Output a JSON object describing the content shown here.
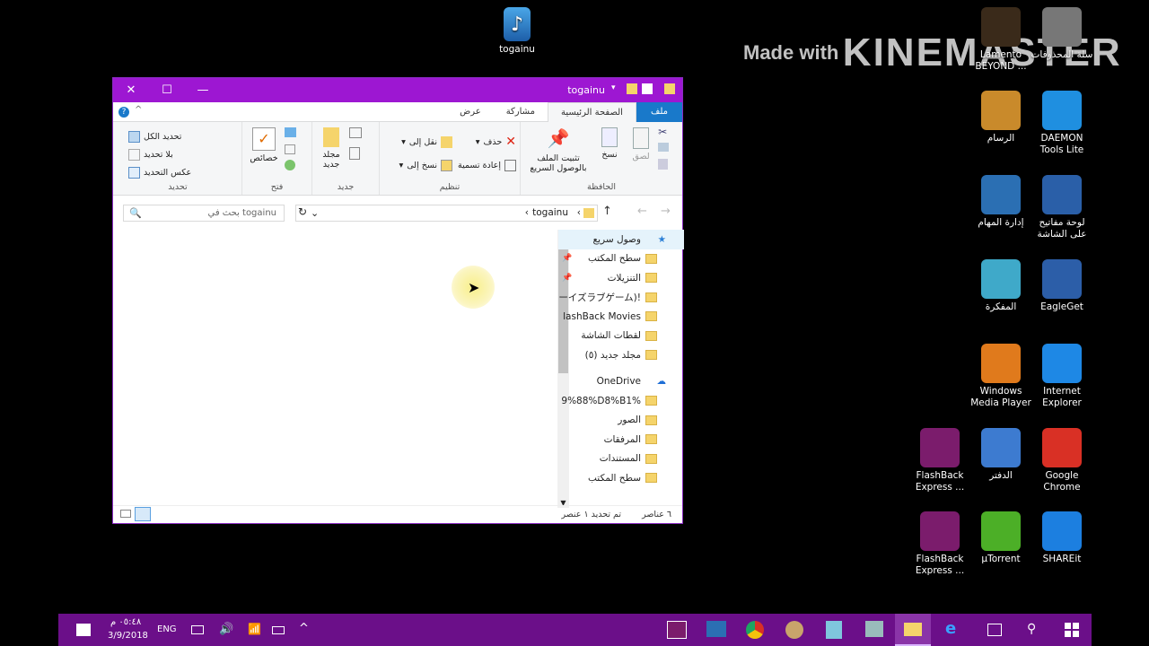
{
  "watermark": {
    "prefix": "Made with",
    "brand": "KINEMASTER"
  },
  "desktop": {
    "top_icon": {
      "label": "togainu"
    },
    "icons": [
      {
        "label": "Lamento BEYOND ...",
        "name": "lamento-icon",
        "color": "#3a2a1a"
      },
      {
        "label": "سلة المحذوفات",
        "name": "recycle-bin-icon",
        "color": "#777777"
      },
      {
        "label": "الرسام",
        "name": "paint-icon",
        "color": "#c98a2b"
      },
      {
        "label": "DAEMON Tools Lite",
        "name": "daemon-tools-icon",
        "color": "#1f8fe0"
      },
      {
        "label": "إدارة المهام",
        "name": "task-manager-icon",
        "color": "#2b6fb3"
      },
      {
        "label": "لوحة مفاتيح على الشاشة",
        "name": "onscreen-keyboard-icon",
        "color": "#2a5fa8"
      },
      {
        "label": "المفكرة",
        "name": "notepad-icon",
        "color": "#3fa9c9"
      },
      {
        "label": "EagleGet",
        "name": "eagleget-icon",
        "color": "#2c5ea8"
      },
      {
        "label": "Windows Media Player",
        "name": "windows-media-player-icon",
        "color": "#e07a1c"
      },
      {
        "label": "Internet Explorer",
        "name": "internet-explorer-icon",
        "color": "#1e88e5"
      },
      {
        "label": "FlashBack Express ...",
        "name": "flashback-express-icon",
        "color": "#7b1c6c"
      },
      {
        "label": "الدفتر",
        "name": "wordpad-icon",
        "color": "#3d7bd0"
      },
      {
        "label": "Google Chrome",
        "name": "google-chrome-icon",
        "color": "#d93025"
      },
      {
        "label": "FlashBack Express ...",
        "name": "flashback-express-icon",
        "color": "#7b1c6c"
      },
      {
        "label": "µTorrent",
        "name": "utorrent-icon",
        "color": "#4caf27"
      },
      {
        "label": "SHAREit",
        "name": "shareit-icon",
        "color": "#1c7fe0"
      }
    ]
  },
  "explorer": {
    "title": "togainu",
    "tabs": {
      "file": "ملف",
      "home": "الصفحة الرئيسية",
      "share": "مشاركة",
      "view": "عرض"
    },
    "ribbon": {
      "clipboard": {
        "group": "الحافظة",
        "pin": "تثبيت الملف بالوصول السريع",
        "copy": "نسخ",
        "paste": "لصق"
      },
      "organize": {
        "group": "تنظيم",
        "move_to": "نقل إلى",
        "copy_to": "نسخ إلى",
        "delete": "حذف",
        "rename": "إعادة تسمية"
      },
      "new": {
        "group": "جديد",
        "new_folder": "مجلد جديد"
      },
      "open": {
        "group": "فتح",
        "properties": "خصائص"
      },
      "select": {
        "group": "تحديد",
        "select_all": "تحديد الكل",
        "select_none": "بلا تحديد",
        "invert": "عكس التحديد"
      }
    },
    "address": {
      "path": "togainu",
      "search_placeholder": "بحث في togainu"
    },
    "nav": {
      "quick_access": "وصول سريع",
      "items": [
        {
          "label": "سطح المكتب",
          "pinned": true
        },
        {
          "label": "التنزيلات",
          "pinned": true
        },
        {
          "label": "ーイズラブゲーム)!",
          "pinned": false
        },
        {
          "label": "lashBack Movies",
          "pinned": false
        },
        {
          "label": "لقطات الشاشة",
          "pinned": false
        },
        {
          "label": "مجلد جديد (٥)",
          "pinned": false
        }
      ],
      "onedrive": "OneDrive",
      "onedrive_items": [
        {
          "label": "9%88%D8%B1%"
        },
        {
          "label": "الصور"
        },
        {
          "label": "المرفقات"
        },
        {
          "label": "المستندات"
        },
        {
          "label": "سطح المكتب"
        }
      ]
    },
    "status": {
      "count": "٦ عناصر",
      "selected": "تم تحديد ١ عنصر"
    }
  },
  "taskbar": {
    "time": "٠٥:٤٨ م",
    "date": "3/9/2018",
    "lang": "ENG",
    "accent": "#6b0f89"
  }
}
